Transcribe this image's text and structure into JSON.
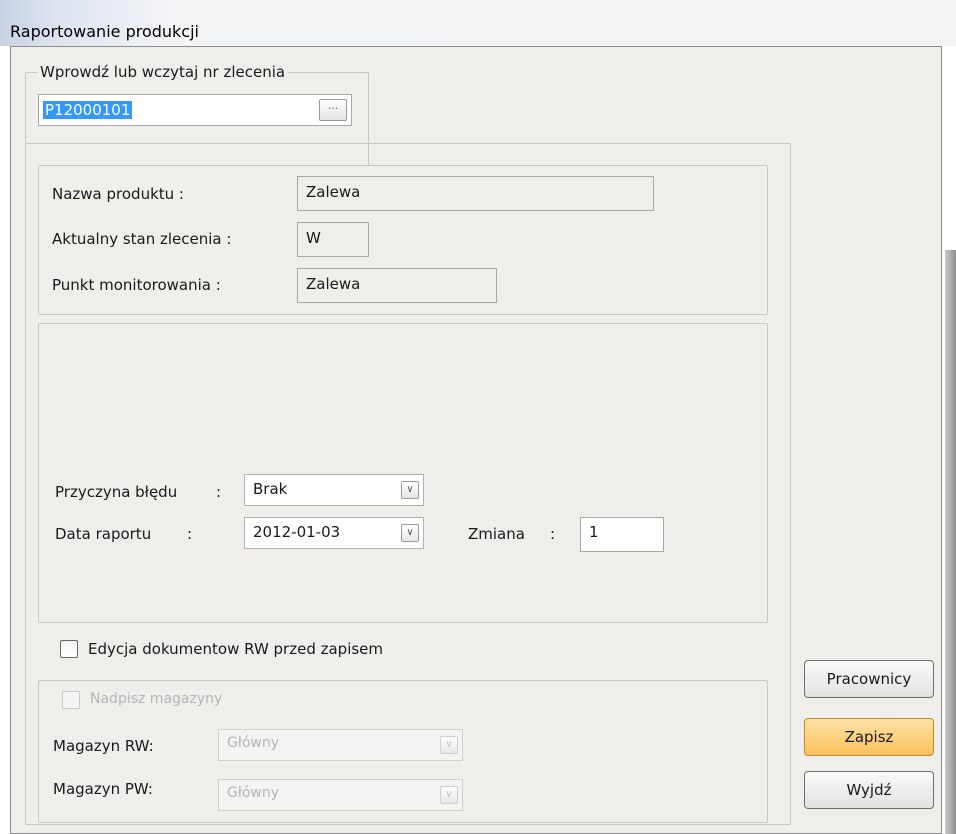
{
  "window": {
    "title": "Raportowanie produkcji"
  },
  "order": {
    "legend": "Wprowdź lub wczytaj nr zlecenia",
    "value": "P12000101",
    "browse_label": "···"
  },
  "product": {
    "name_label": "Nazwa produktu :",
    "name_value": "Zalewa",
    "status_label": "Aktualny stan zlecenia :",
    "status_value": "W",
    "point_label": "Punkt monitorowania :",
    "point_value": "Zalewa"
  },
  "report": {
    "reason_label": "Przyczyna błędu",
    "reason_colon": ":",
    "reason_value": "Brak",
    "date_label": "Data raportu",
    "date_colon": ":",
    "date_value": "2012-01-03",
    "shift_label": "Zmiana",
    "shift_colon": ":",
    "shift_value": "1"
  },
  "options": {
    "edit_rw_label": "Edycja dokumentow RW przed zapisem",
    "edit_rw_checked": false
  },
  "warehouses": {
    "override_label": "Nadpisz magazyny",
    "override_checked": false,
    "rw_label": "Magazyn RW:",
    "rw_value": "Główny",
    "pw_label": "Magazyn PW:",
    "pw_value": "Główny"
  },
  "buttons": {
    "workers": "Pracownicy",
    "save": "Zapisz",
    "exit": "Wyjdź"
  },
  "icons": {
    "dropdown": "chevron-down-icon"
  },
  "colors": {
    "selection": "#3399ff",
    "primary_button": "#fbc15c",
    "window_bg": "#f0eeea"
  }
}
